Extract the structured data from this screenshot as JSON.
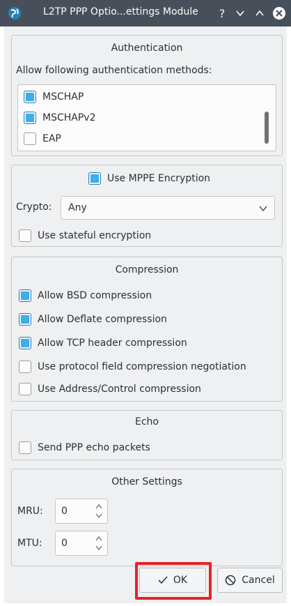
{
  "titlebar": {
    "title": "L2TP PPP Optio...ettings Module",
    "help_glyph": "?",
    "minimize_glyph": "⌄",
    "maximize_glyph": "⌃",
    "close_glyph": "⊗"
  },
  "authentication": {
    "title": "Authentication",
    "prompt": "Allow following authentication methods:",
    "methods": [
      {
        "label": "MSCHAP",
        "checked": true
      },
      {
        "label": "MSCHAPv2",
        "checked": true
      },
      {
        "label": "EAP",
        "checked": false
      }
    ]
  },
  "encryption": {
    "mppe_label": "Use MPPE Encryption",
    "mppe_checked": true,
    "crypto_label": "Crypto:",
    "crypto_value": "Any",
    "stateful_label": "Use stateful encryption",
    "stateful_checked": false
  },
  "compression": {
    "title": "Compression",
    "options": [
      {
        "label": "Allow BSD compression",
        "checked": true
      },
      {
        "label": "Allow Deflate compression",
        "checked": true
      },
      {
        "label": "Allow TCP header compression",
        "checked": true
      },
      {
        "label": "Use protocol field compression negotiation",
        "checked": false
      },
      {
        "label": "Use Address/Control compression",
        "checked": false
      }
    ]
  },
  "echo": {
    "title": "Echo",
    "send_label": "Send PPP echo packets",
    "send_checked": false
  },
  "other": {
    "title": "Other Settings",
    "mru_label": "MRU:",
    "mru_value": "0",
    "mtu_label": "MTU:",
    "mtu_value": "0"
  },
  "buttons": {
    "ok_label": "OK",
    "cancel_label": "Cancel"
  },
  "colors": {
    "accent": "#3daee9",
    "titlebar": "#47505a",
    "highlight": "#e4222b"
  }
}
